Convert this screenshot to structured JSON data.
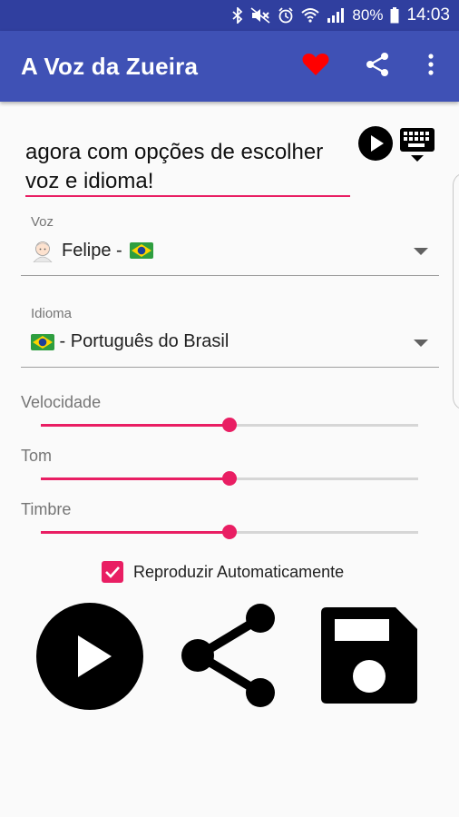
{
  "status_bar": {
    "battery": "80%",
    "time": "14:03"
  },
  "app_bar": {
    "title": "A Voz da Zueira",
    "heart_color": "#ff0000"
  },
  "text_input": {
    "value_line1": "agora com opções de escolher",
    "value_line2": "voz e idioma!"
  },
  "voice": {
    "label": "Voz",
    "value": "Felipe - "
  },
  "language": {
    "label": "Idioma",
    "value": " - Português do Brasil"
  },
  "sliders": [
    {
      "label": "Velocidade",
      "level": 0.5
    },
    {
      "label": "Tom",
      "level": 0.5
    },
    {
      "label": "Timbre",
      "level": 0.5
    }
  ],
  "autoplay": {
    "label": "Reproduzir Automaticamente",
    "checked": true
  },
  "accent_color": "#e91e63",
  "primary_color": "#3f51b5",
  "icons": [
    "bluetooth-icon",
    "mute-icon",
    "alarm-icon",
    "wifi-icon",
    "signal-icon",
    "battery-icon",
    "heart-icon",
    "share-icon",
    "more-vert-icon",
    "play-icon",
    "keyboard-icon",
    "brazil-flag-icon",
    "avatar-icon",
    "dropdown-arrow-icon",
    "save-icon"
  ]
}
